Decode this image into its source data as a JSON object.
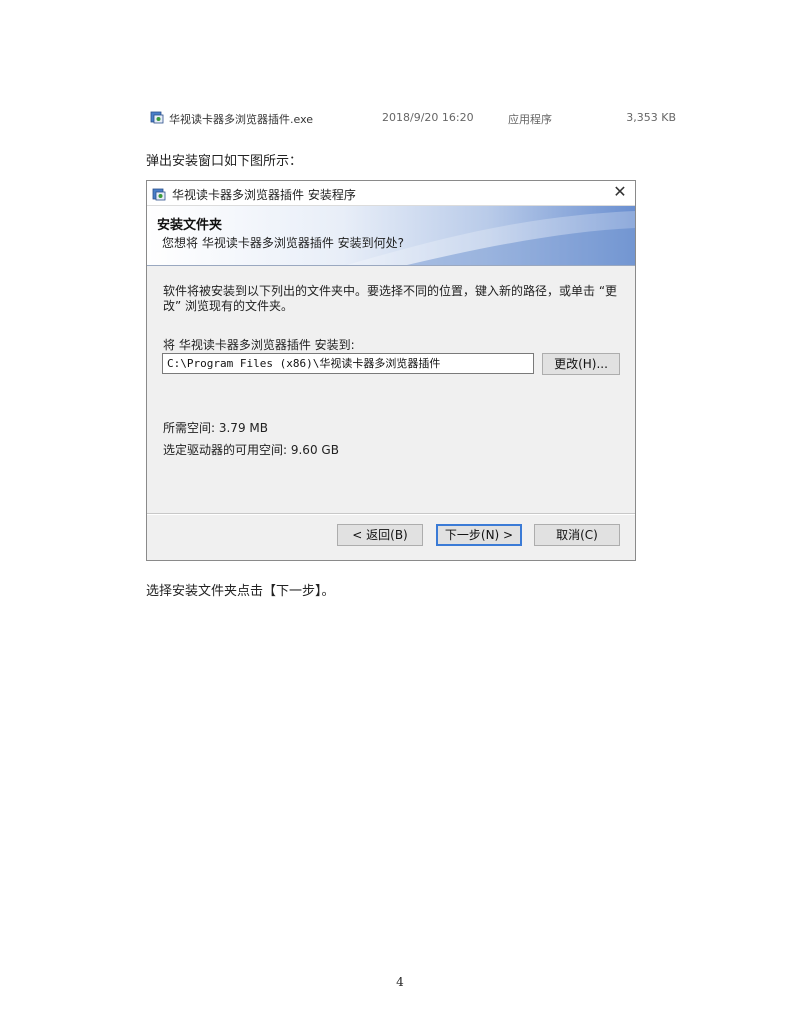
{
  "file_listing": {
    "icon": "installer-icon",
    "name": "华视读卡器多浏览器插件.exe",
    "date": "2018/9/20 16:20",
    "type": "应用程序",
    "size": "3,353 KB"
  },
  "intro_text": "弹出安装窗口如下图所示：",
  "dialog": {
    "title": "华视读卡器多浏览器插件 安装程序",
    "close_symbol": "✕",
    "banner": {
      "title": "安装文件夹",
      "subtitle": "您想将 华视读卡器多浏览器插件 安装到何处?"
    },
    "description": "软件将被安装到以下列出的文件夹中。要选择不同的位置，键入新的路径，或单击 “更改” 浏览现有的文件夹。",
    "destination_label": "将 华视读卡器多浏览器插件 安装到:",
    "destination_path": "C:\\Program Files (x86)\\华视读卡器多浏览器插件",
    "change_button": "更改(H)...",
    "space_required": "所需空间: 3.79 MB",
    "space_available": "选定驱动器的可用空间: 9.60 GB",
    "back_button": "< 返回(B)",
    "next_button": "下一步(N) >",
    "cancel_button": "取消(C)"
  },
  "instruction_text": "选择安装文件夹点击【下一步】。",
  "page_number": "4"
}
